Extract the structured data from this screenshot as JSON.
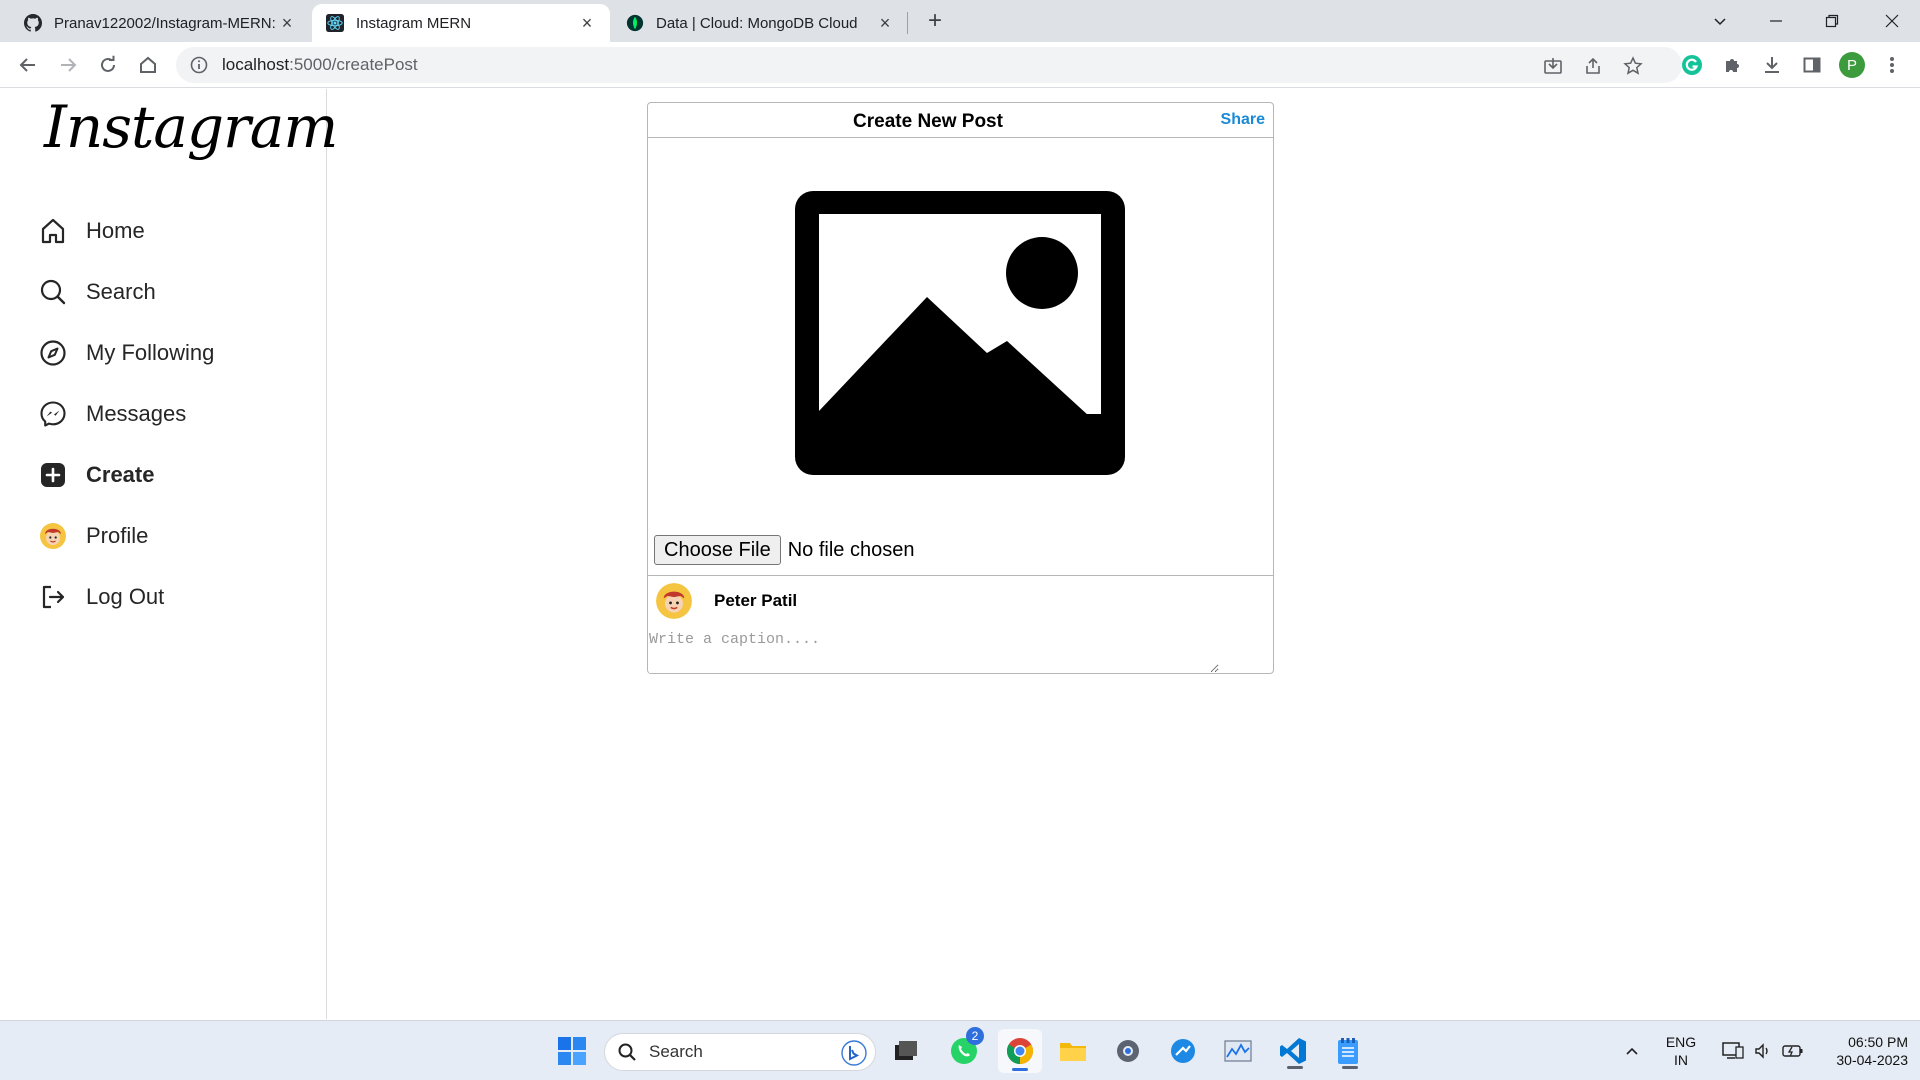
{
  "browser": {
    "tabs": [
      {
        "label": "Pranav122002/Instagram-MERN:",
        "icon": "github-icon",
        "active": false
      },
      {
        "label": "Instagram MERN",
        "icon": "react-icon",
        "active": true
      },
      {
        "label": "Data | Cloud: MongoDB Cloud",
        "icon": "mongodb-leaf-icon",
        "active": false
      }
    ],
    "url_host": "localhost",
    "url_path": ":5000/createPost",
    "profile_initial": "P"
  },
  "app": {
    "logo": "Instagram",
    "nav": [
      {
        "label": "Home",
        "icon": "home-icon"
      },
      {
        "label": "Search",
        "icon": "search-icon"
      },
      {
        "label": "My Following",
        "icon": "compass-icon"
      },
      {
        "label": "Messages",
        "icon": "messenger-icon"
      },
      {
        "label": "Create",
        "icon": "plus-square-icon",
        "bold": true
      },
      {
        "label": "Profile",
        "icon": "profile-avatar"
      },
      {
        "label": "Log Out",
        "icon": "logout-icon"
      }
    ]
  },
  "create_post": {
    "title": "Create New Post",
    "share_label": "Share",
    "choose_file_label": "Choose File",
    "file_status": "No file chosen",
    "author_name": "Peter Patil",
    "caption_placeholder": "Write a caption....",
    "preview_icon": "image-placeholder-icon"
  },
  "taskbar": {
    "search_label": "Search",
    "whatsapp_badge": "2",
    "lang_line1": "ENG",
    "lang_line2": "IN",
    "time": "06:50 PM",
    "date": "30-04-2023"
  },
  "colors": {
    "accent": "#1a8ad6",
    "border": "#b6b6b6",
    "taskbar_bg": "#e6ecf5",
    "tab_strip": "#dee1e6"
  }
}
